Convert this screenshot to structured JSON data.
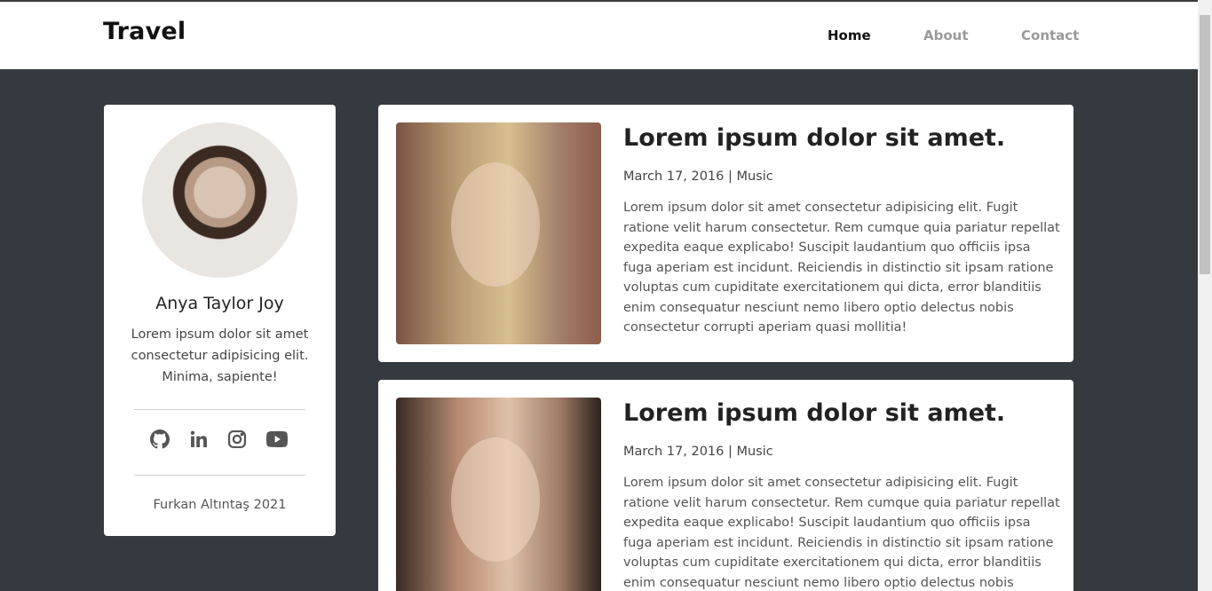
{
  "nav": {
    "brand": "Travel",
    "links": [
      {
        "label": "Home",
        "active": true
      },
      {
        "label": "About",
        "active": false
      },
      {
        "label": "Contact",
        "active": false
      }
    ]
  },
  "profile": {
    "name": "Anya Taylor Joy",
    "bio": "Lorem ipsum dolor sit amet consectetur adipisicing elit. Minima, sapiente!",
    "socials": [
      "github-icon",
      "linkedin-icon",
      "instagram-icon",
      "youtube-icon"
    ],
    "footer": "Furkan Altıntaş 2021"
  },
  "posts": [
    {
      "title": "Lorem ipsum dolor sit amet.",
      "meta": "March 17, 2016 | Music",
      "text": "Lorem ipsum dolor sit amet consectetur adipisicing elit. Fugit ratione velit harum consectetur. Rem cumque quia pariatur repellat expedita eaque explicabo! Suscipit laudantium quo officiis ipsa fuga aperiam est incidunt. Reiciendis in distinctio sit ipsam ratione voluptas cum cupiditate exercitationem qui dicta, error blanditiis enim consequatur nesciunt nemo libero optio delectus nobis consectetur corrupti aperiam quasi mollitia!"
    },
    {
      "title": "Lorem ipsum dolor sit amet.",
      "meta": "March 17, 2016 | Music",
      "text": "Lorem ipsum dolor sit amet consectetur adipisicing elit. Fugit ratione velit harum consectetur. Rem cumque quia pariatur repellat expedita eaque explicabo! Suscipit laudantium quo officiis ipsa fuga aperiam est incidunt. Reiciendis in distinctio sit ipsam ratione voluptas cum cupiditate exercitationem qui dicta, error blanditiis enim consequatur nesciunt nemo libero optio delectus nobis consectetur"
    }
  ],
  "colors": {
    "background": "#343a40",
    "card": "#ffffff",
    "navbar": "#ffffff",
    "link_inactive": "#9a9a9a",
    "link_active": "#111111"
  }
}
